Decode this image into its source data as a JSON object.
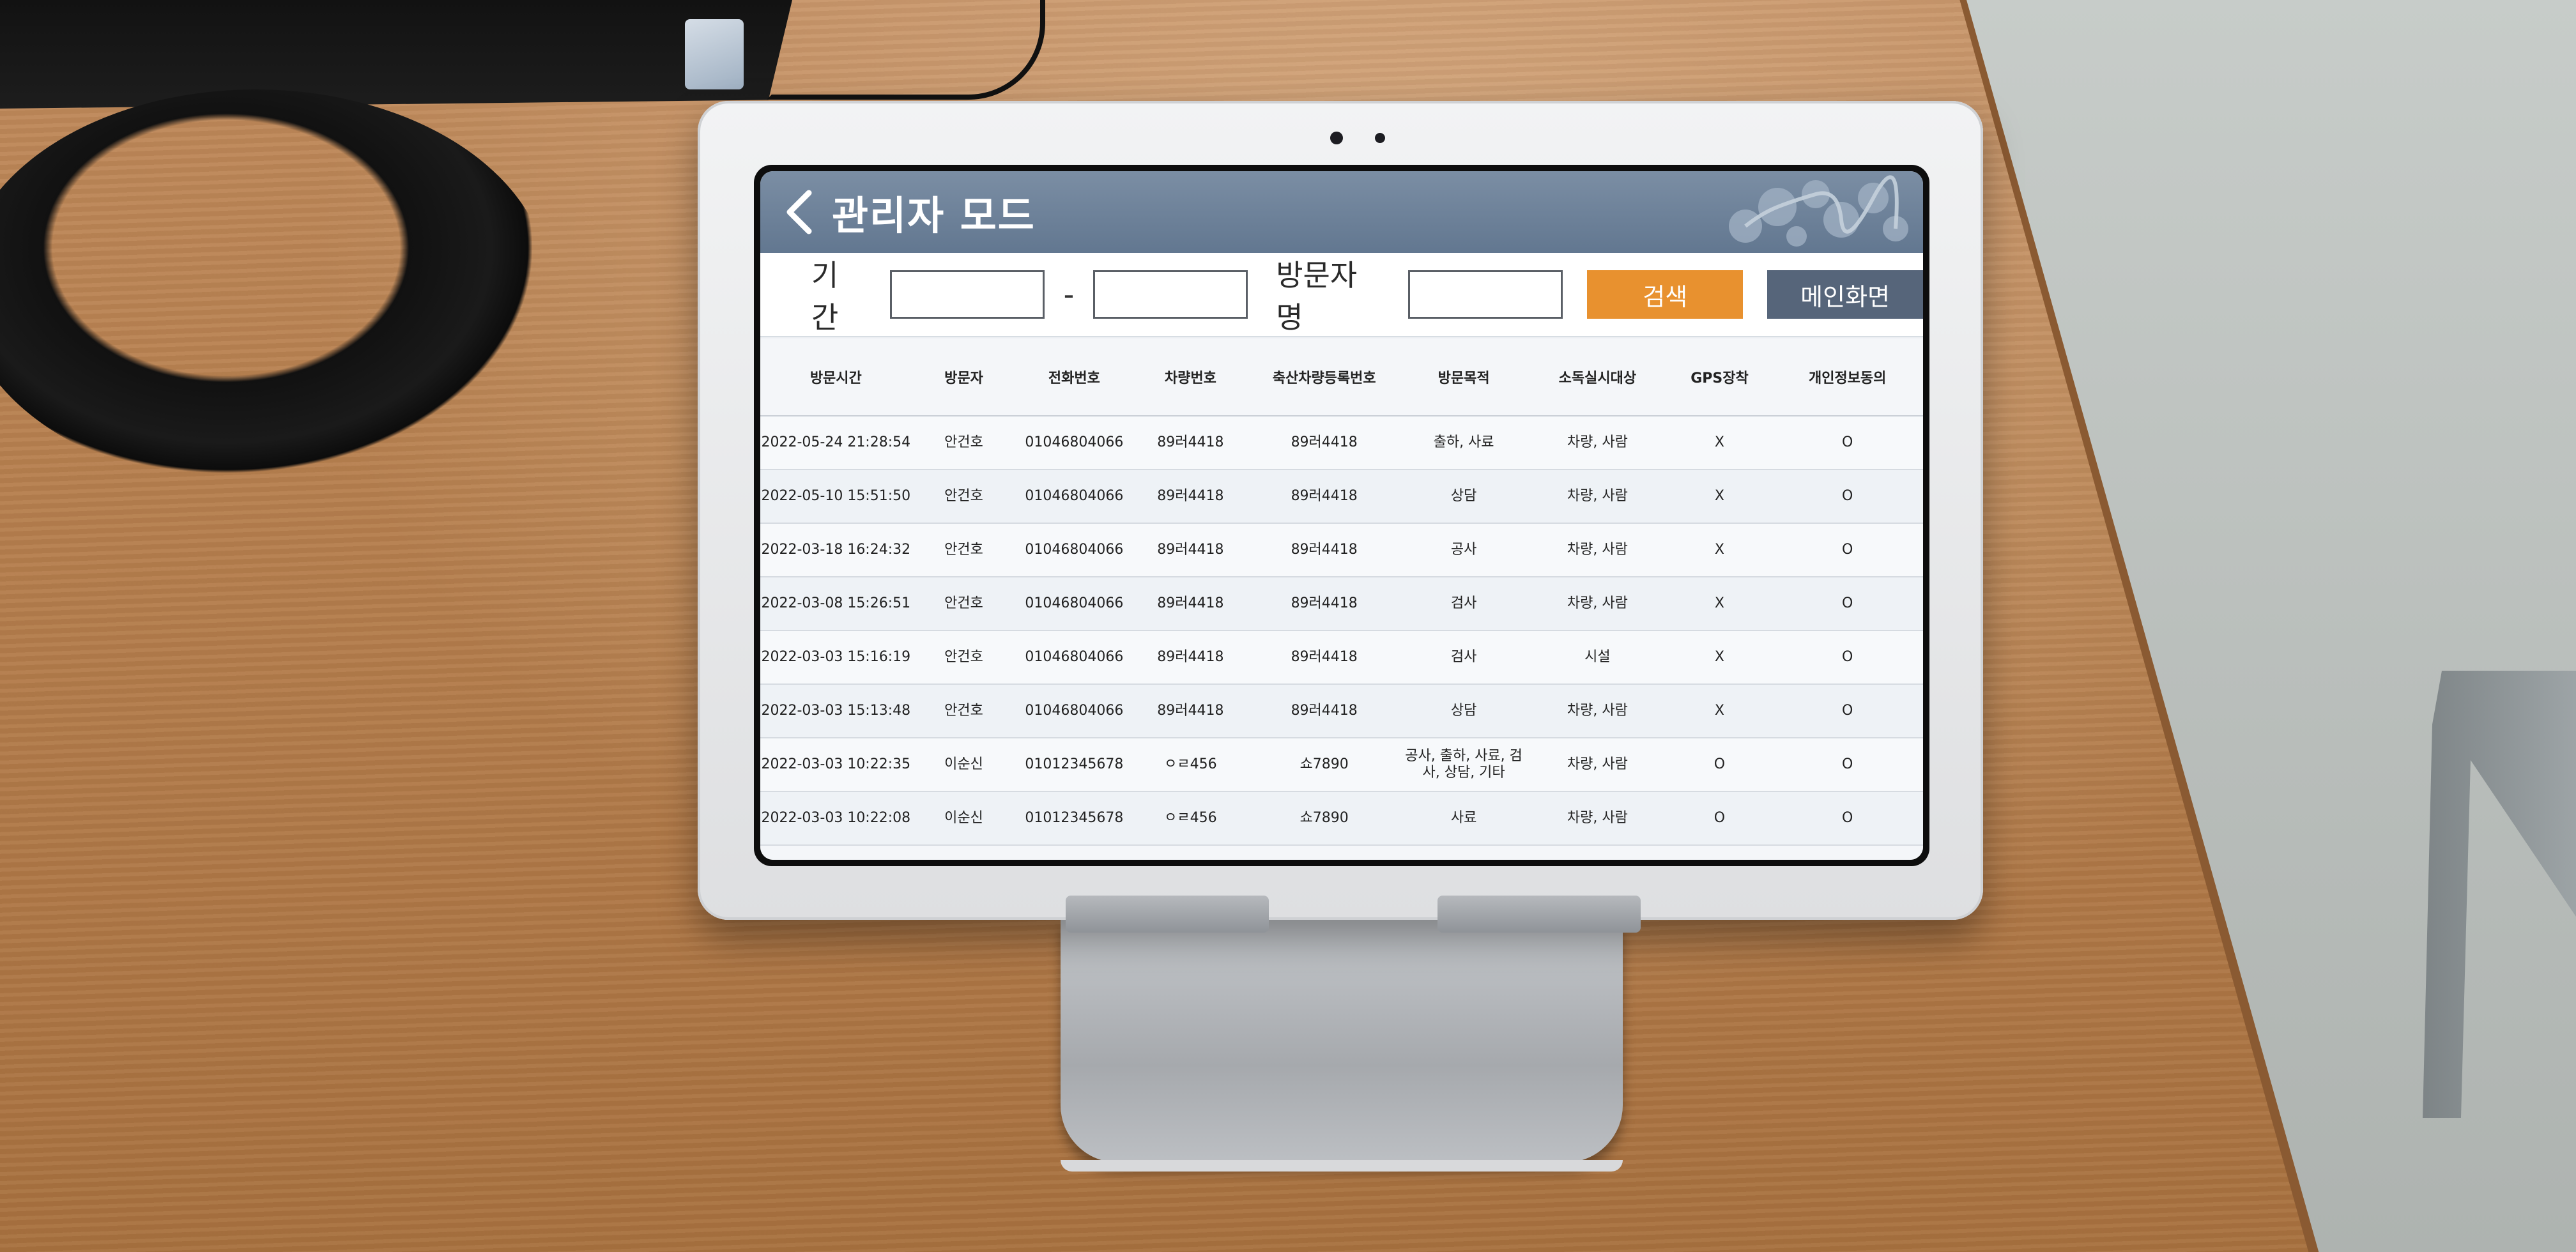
{
  "app": {
    "back_icon": "chevron-left-icon",
    "title": "관리자 모드"
  },
  "search": {
    "period_label": "기간",
    "start_value": "",
    "separator": "-",
    "end_value": "",
    "visitor_label": "방문자명",
    "visitor_value": "",
    "search_label": "검색",
    "main_label": "메인화면"
  },
  "colors": {
    "header": "#6b7f97",
    "search_button": "#e8912f",
    "main_button": "#56657a"
  },
  "table": {
    "headers": [
      "방문시간",
      "방문자",
      "전화번호",
      "차량번호",
      "축산차량등록번호",
      "방문목적",
      "소독실시대상",
      "GPS장착",
      "개인정보동의"
    ],
    "rows": [
      [
        "2022-05-24 21:28:54",
        "안건호",
        "01046804066",
        "89러4418",
        "89러4418",
        "출하, 사료",
        "차량, 사람",
        "X",
        "O"
      ],
      [
        "2022-05-10 15:51:50",
        "안건호",
        "01046804066",
        "89러4418",
        "89러4418",
        "상담",
        "차량, 사람",
        "X",
        "O"
      ],
      [
        "2022-03-18 16:24:32",
        "안건호",
        "01046804066",
        "89러4418",
        "89러4418",
        "공사",
        "차량, 사람",
        "X",
        "O"
      ],
      [
        "2022-03-08 15:26:51",
        "안건호",
        "01046804066",
        "89러4418",
        "89러4418",
        "검사",
        "차량, 사람",
        "X",
        "O"
      ],
      [
        "2022-03-03 15:16:19",
        "안건호",
        "01046804066",
        "89러4418",
        "89러4418",
        "검사",
        "시설",
        "X",
        "O"
      ],
      [
        "2022-03-03 15:13:48",
        "안건호",
        "01046804066",
        "89러4418",
        "89러4418",
        "상담",
        "차량, 사람",
        "X",
        "O"
      ],
      [
        "2022-03-03 10:22:35",
        "이순신",
        "01012345678",
        "ㅇㄹ456",
        "쇼7890",
        "공사, 출하, 사료, 검사, 상담, 기타",
        "차량, 사람",
        "O",
        "O"
      ],
      [
        "2022-03-03 10:22:08",
        "이순신",
        "01012345678",
        "ㅇㄹ456",
        "쇼7890",
        "사료",
        "차량, 사람",
        "O",
        "O"
      ]
    ]
  }
}
